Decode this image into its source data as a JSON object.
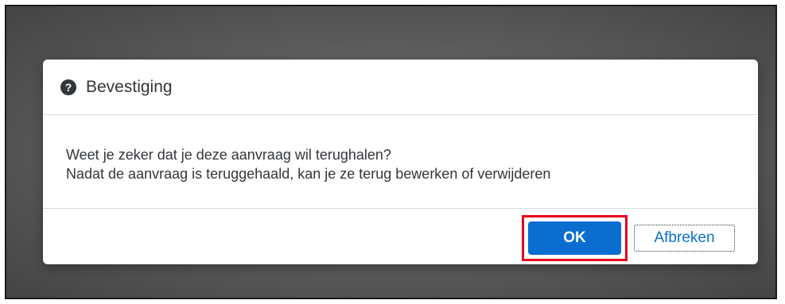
{
  "dialog": {
    "title": "Bevestiging",
    "icon": "question-circle-icon",
    "message_line1": "Weet je zeker dat je deze aanvraag wil terughalen?",
    "message_line2": "Nadat de aanvraag is teruggehaald, kan je ze terug bewerken of verwijderen",
    "ok_label": "OK",
    "cancel_label": "Afbreken"
  },
  "colors": {
    "primary_button": "#0a6ed1",
    "highlight_border": "#e4001c",
    "text": "#32363a",
    "overlay": "#5a5a5a"
  }
}
